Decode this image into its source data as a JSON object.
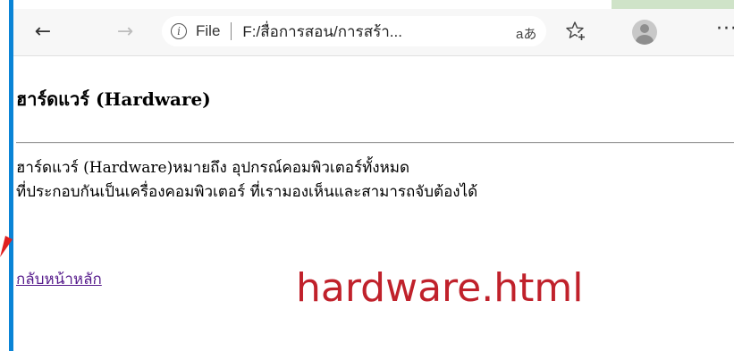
{
  "browser": {
    "back_icon": "arrow-left",
    "forward_icon": "arrow-right",
    "address": {
      "info_icon": "info-circle",
      "info_glyph": "i",
      "scheme_label": "File",
      "url": "F:/สื่อการสอน/การสร้า..."
    },
    "read_aloud_label": "aあ",
    "favorites_icon": "star-plus",
    "profile_icon": "avatar",
    "more_label": "···"
  },
  "page": {
    "heading": "ฮาร์ดแวร์ (Hardware)",
    "paragraph_lines": [
      "ฮาร์ดแวร์ (Hardware)หมายถึง อุปกรณ์คอมพิวเตอร์ทั้งหมด",
      "ที่ประกอบกันเป็นเครื่องคอมพิวเตอร์ ที่เรามองเห็นและสามารถจับต้องได้"
    ],
    "back_link": "กลับหน้าหลัก"
  },
  "annotation": {
    "filename": "hardware.html",
    "color": "#c0212b"
  },
  "colors": {
    "window_border": "#0a84d6",
    "link_visited": "#551a8b",
    "arrow": "#e02020"
  }
}
